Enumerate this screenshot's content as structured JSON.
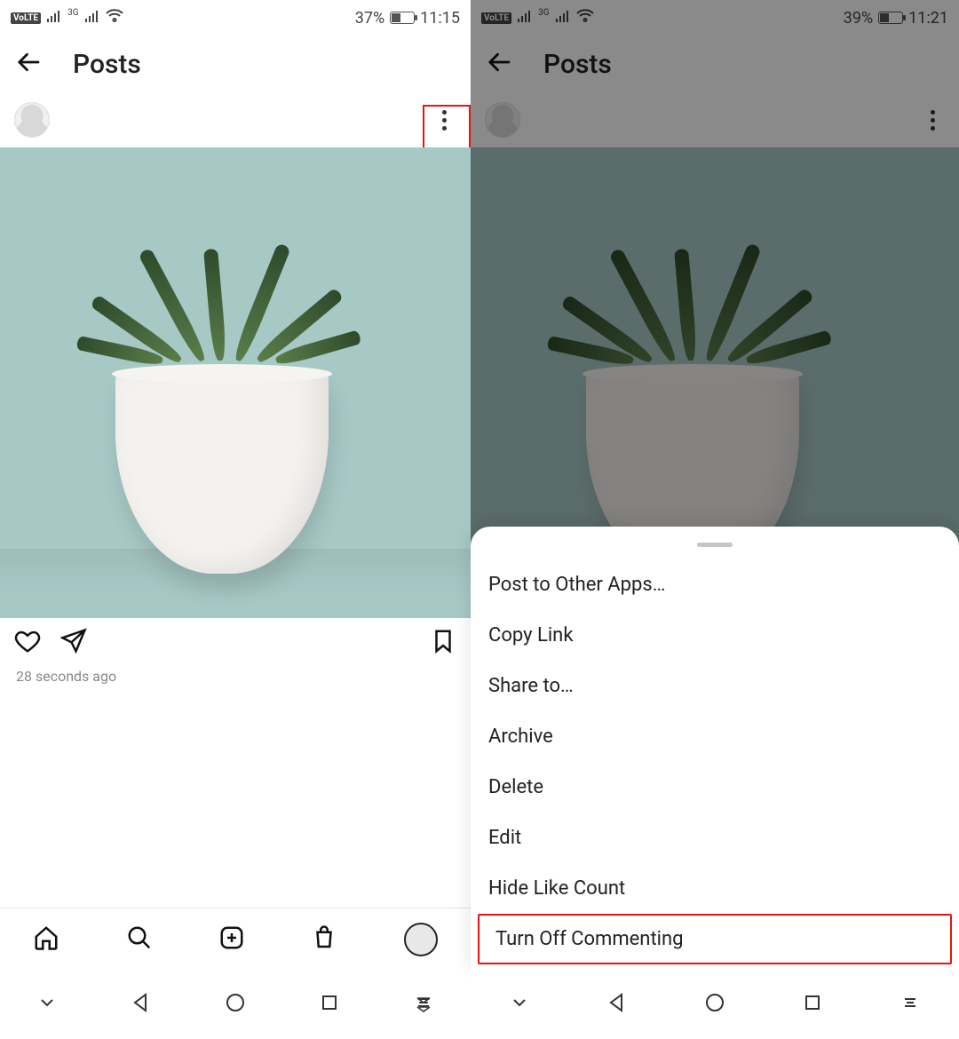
{
  "left": {
    "status": {
      "battery": "37%",
      "time": "11:15",
      "volte": "VoLTE",
      "net": "3G"
    },
    "header": {
      "title": "Posts"
    },
    "post": {
      "timestamp": "28 seconds ago"
    }
  },
  "right": {
    "status": {
      "battery": "39%",
      "time": "11:21",
      "volte": "VoLTE",
      "net": "3G"
    },
    "header": {
      "title": "Posts"
    },
    "menu": {
      "items": [
        "Post to Other Apps…",
        "Copy Link",
        "Share to…",
        "Archive",
        "Delete",
        "Edit",
        "Hide Like Count",
        "Turn Off Commenting"
      ],
      "highlight_index": 7
    }
  }
}
